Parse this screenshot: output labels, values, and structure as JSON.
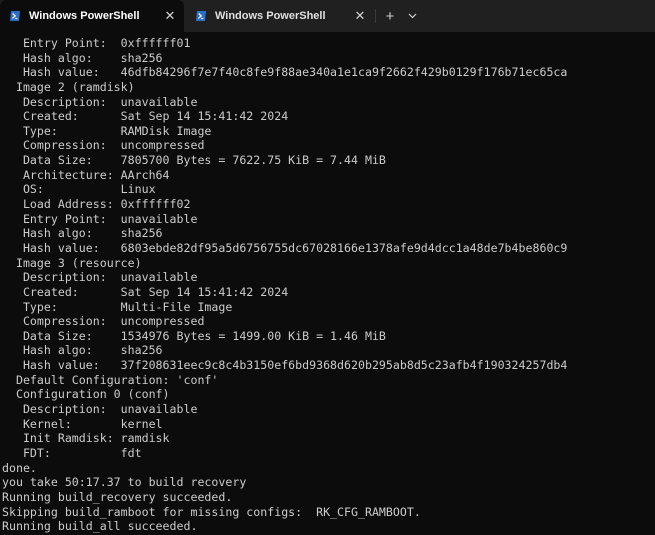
{
  "tabs": [
    {
      "title": "Windows PowerShell",
      "icon": "powershell-icon",
      "active": true
    },
    {
      "title": "Windows PowerShell",
      "icon": "powershell-icon",
      "active": false
    }
  ],
  "new_tab_label": "+",
  "terminal": {
    "lines": [
      "   Entry Point:  0xffffff01",
      "   Hash algo:    sha256",
      "   Hash value:   46dfb84296f7e7f40c8fe9f88ae340a1e1ca9f2662f429b0129f176b71ec65ca",
      "  Image 2 (ramdisk)",
      "   Description:  unavailable",
      "   Created:      Sat Sep 14 15:41:42 2024",
      "   Type:         RAMDisk Image",
      "   Compression:  uncompressed",
      "   Data Size:    7805700 Bytes = 7622.75 KiB = 7.44 MiB",
      "   Architecture: AArch64",
      "   OS:           Linux",
      "   Load Address: 0xffffff02",
      "   Entry Point:  unavailable",
      "   Hash algo:    sha256",
      "   Hash value:   6803ebde82df95a5d6756755dc67028166e1378afe9d4dcc1a48de7b4be860c9",
      "  Image 3 (resource)",
      "   Description:  unavailable",
      "   Created:      Sat Sep 14 15:41:42 2024",
      "   Type:         Multi-File Image",
      "   Compression:  uncompressed",
      "   Data Size:    1534976 Bytes = 1499.00 KiB = 1.46 MiB",
      "   Hash algo:    sha256",
      "   Hash value:   37f208631eec9c8c4b3150ef6bd9368d620b295ab8d5c23afb4f190324257db4",
      "  Default Configuration: 'conf'",
      "  Configuration 0 (conf)",
      "   Description:  unavailable",
      "   Kernel:       kernel",
      "   Init Ramdisk: ramdisk",
      "   FDT:          fdt",
      "done.",
      "you take 50:17.37 to build recovery",
      "Running build_recovery succeeded.",
      "Skipping build_ramboot for missing configs:  RK_CFG_RAMBOOT.",
      "Running build_all succeeded."
    ]
  },
  "colors": {
    "background": "#0c0c0c",
    "tabbar": "#202020",
    "text": "#cccccc",
    "powershell_blue": "#2b6fc9"
  }
}
